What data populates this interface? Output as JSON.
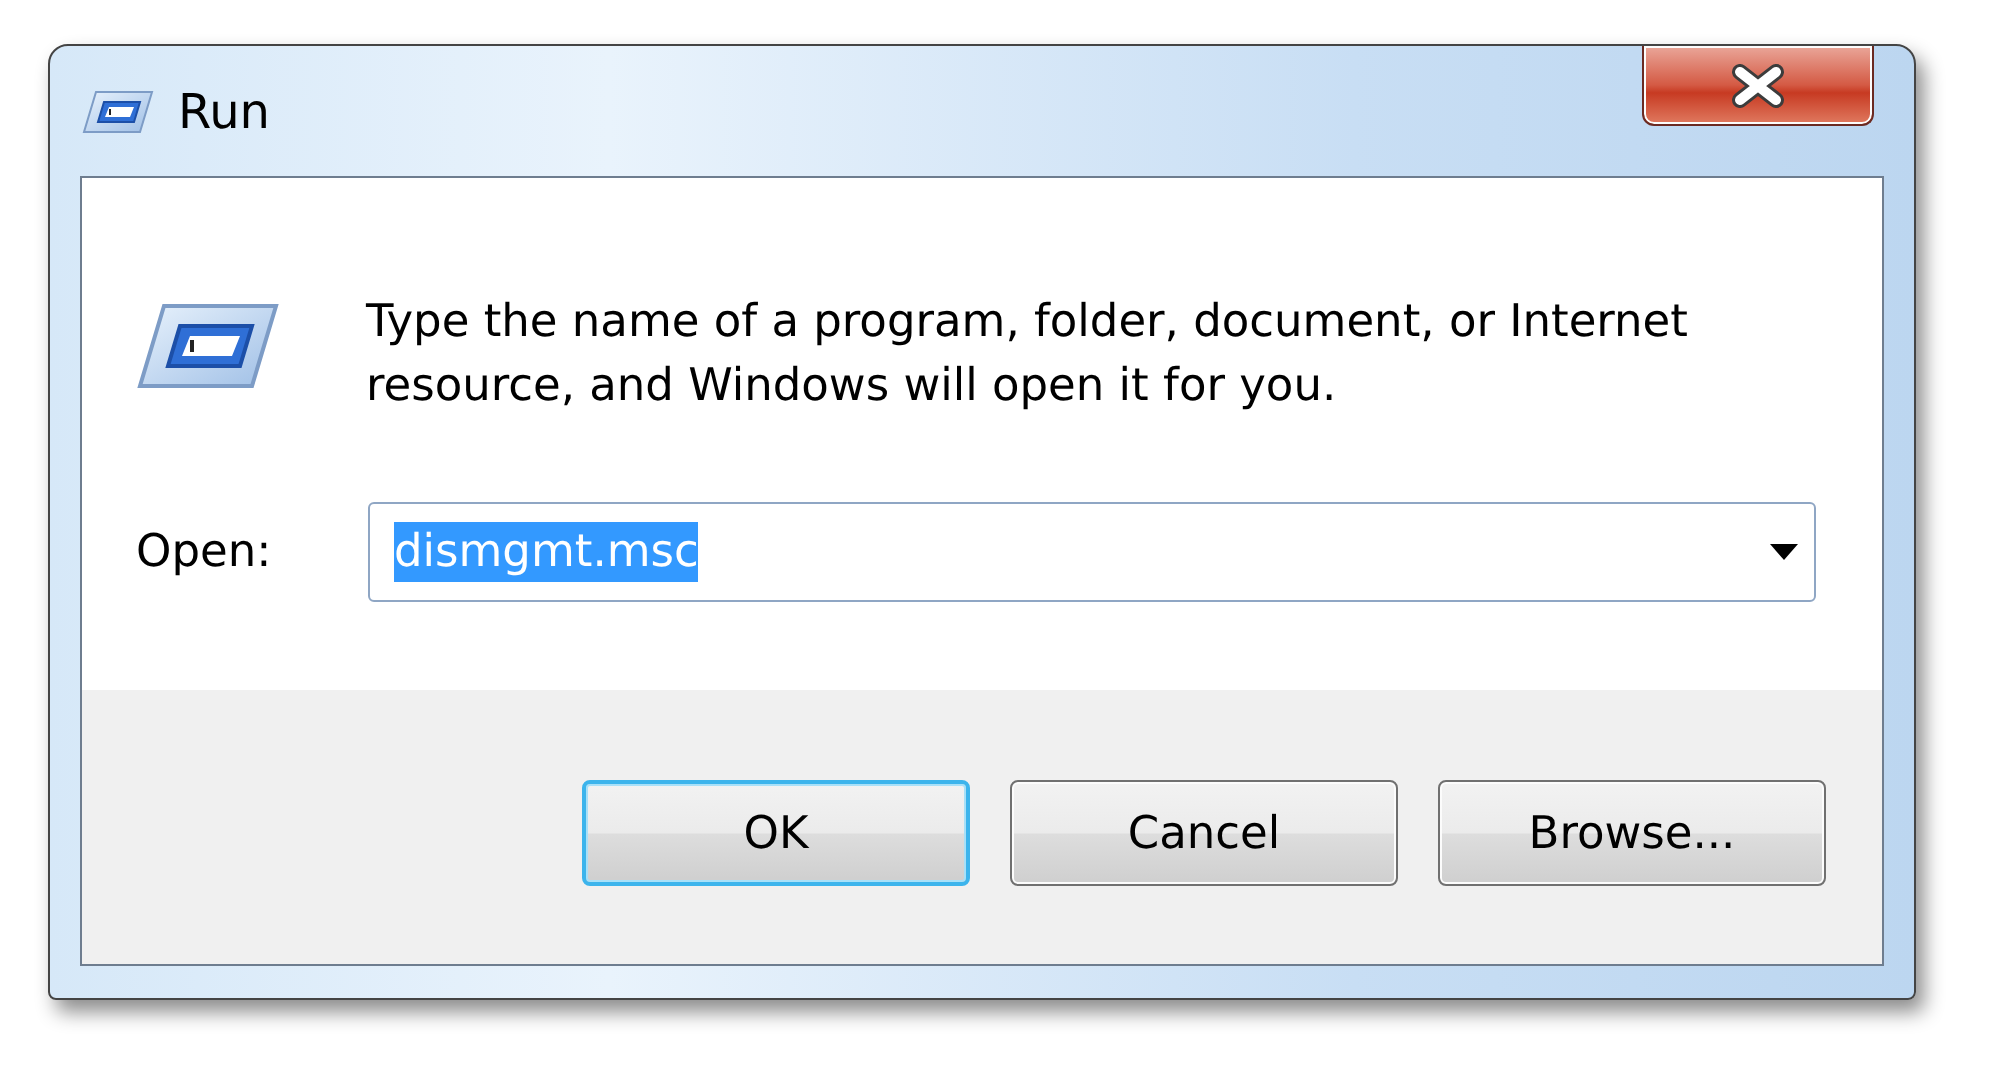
{
  "window": {
    "title": "Run"
  },
  "message": "Type the name of a program, folder, document, or Internet resource, and Windows will open it for you.",
  "open_field": {
    "label": "Open:",
    "value": "dismgmt.msc",
    "selected": true
  },
  "buttons": [
    {
      "label": "OK",
      "focused": true
    },
    {
      "label": "Cancel",
      "focused": false
    },
    {
      "label": "Browse...",
      "focused": false
    }
  ]
}
